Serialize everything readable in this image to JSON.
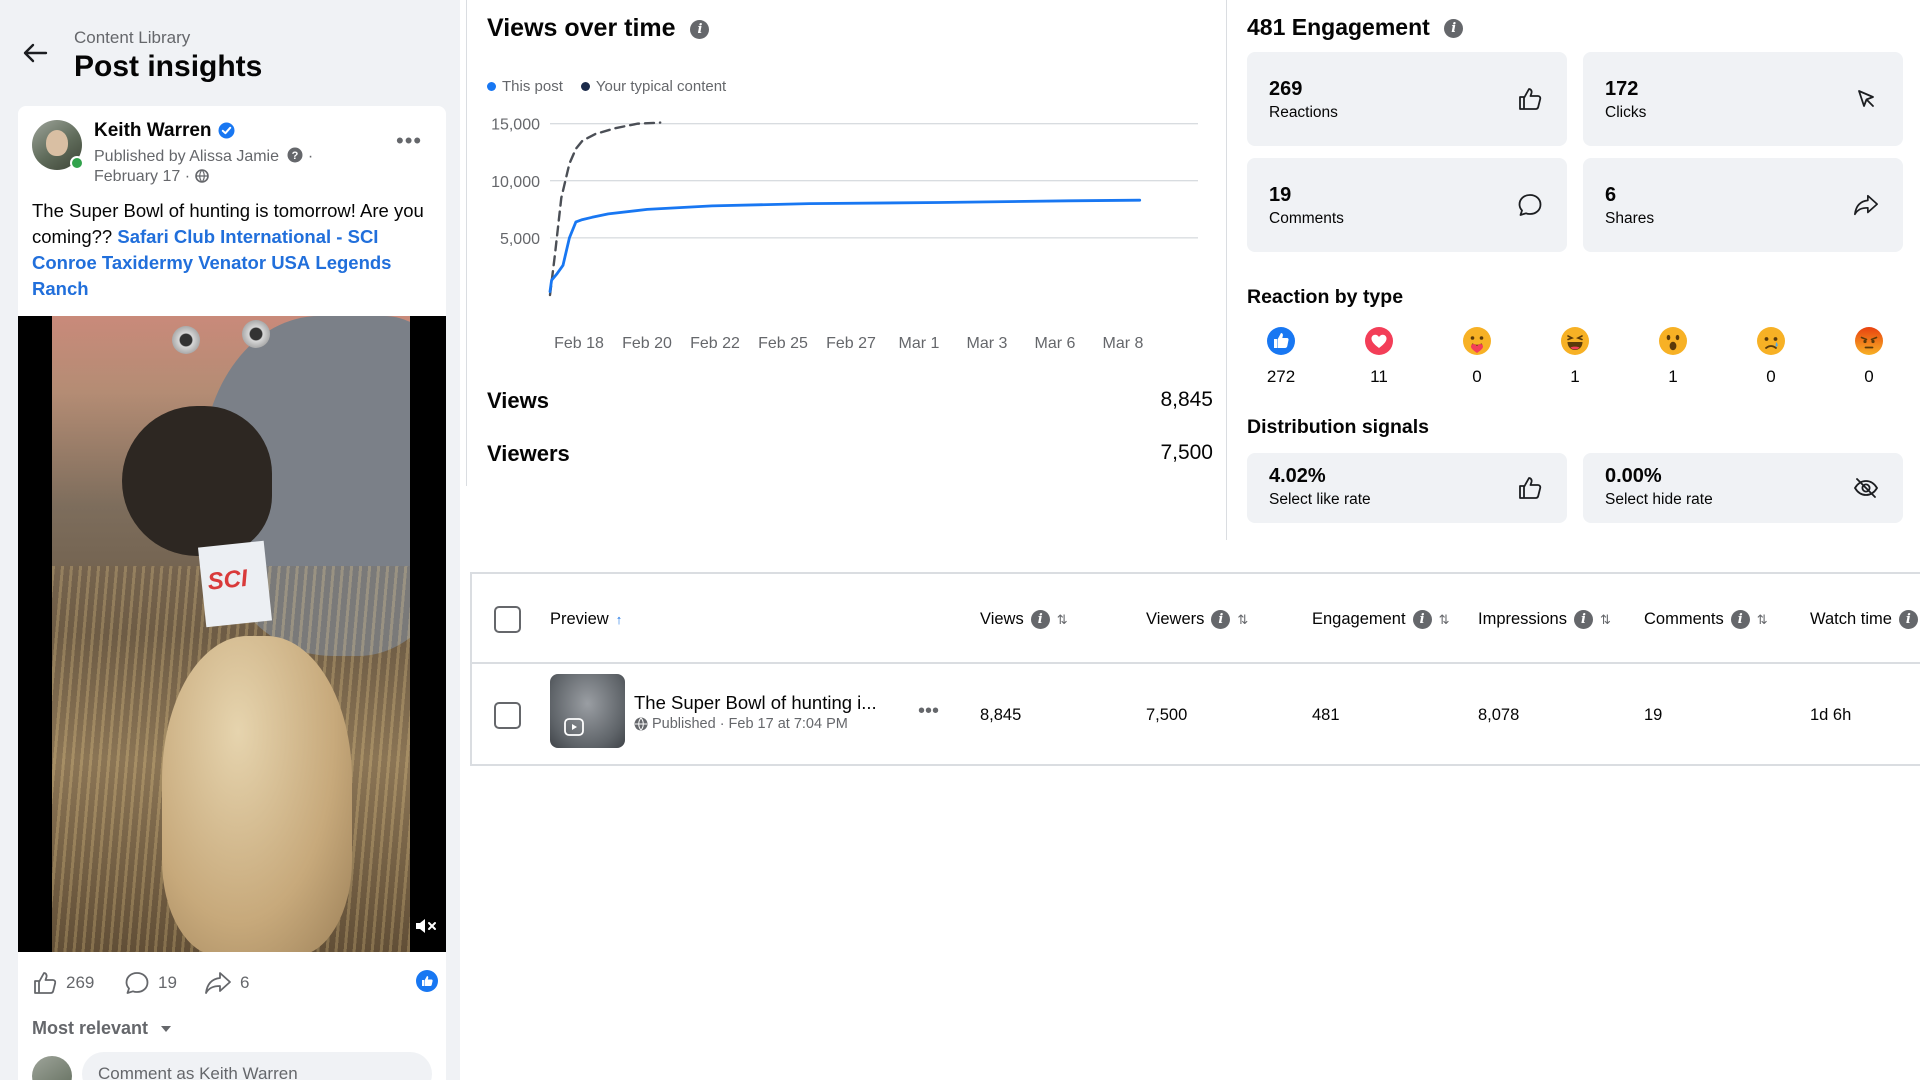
{
  "header": {
    "breadcrumb": "Content Library",
    "title": "Post insights"
  },
  "post": {
    "author": "Keith Warren",
    "published_prefix": "Published by",
    "published_by": "Alissa Jamie",
    "date": "February 17 ·",
    "text": "The Super Bowl of hunting is tomorrow! Are you coming??",
    "tags": [
      "Safari Club International -",
      "SCI Conroe Taxidermy",
      "Venator USA",
      "Legends Ranch"
    ],
    "video_sign_text": "SCI",
    "reactions_count": "269",
    "comments_count": "19",
    "shares_count": "6",
    "sort_label": "Most relevant",
    "comment_placeholder": "Comment as Keith Warren"
  },
  "views_chart": {
    "title": "Views over time",
    "legend": [
      {
        "label": "This post",
        "color": "#1877f2"
      },
      {
        "label": "Your typical content",
        "color": "#1c2b4a"
      }
    ],
    "views_label": "Views",
    "views_value": "8,845",
    "viewers_label": "Viewers",
    "viewers_value": "7,500"
  },
  "chart_data": {
    "type": "line",
    "x_tick_labels": [
      "Feb 18",
      "Feb 20",
      "Feb 22",
      "Feb 25",
      "Feb 27",
      "Mar 1",
      "Mar 3",
      "Mar 6",
      "Mar 8"
    ],
    "y_tick_labels": [
      "15,000",
      "10,000",
      "5,000"
    ],
    "y_ticks": [
      15000,
      10000,
      5000
    ],
    "ylim": [
      0,
      15500
    ],
    "xlim": [
      0,
      20
    ],
    "grid": true,
    "series": [
      {
        "name": "This post",
        "color": "#1877f2",
        "style": "solid",
        "x": [
          0,
          0.05,
          0.2,
          0.4,
          0.6,
          0.8,
          1,
          1.3,
          1.8,
          3,
          5,
          8,
          12,
          16,
          18.2
        ],
        "y": [
          300,
          1300,
          1800,
          2600,
          5000,
          6400,
          6600,
          6800,
          7100,
          7500,
          7800,
          8000,
          8100,
          8250,
          8300
        ]
      },
      {
        "name": "Your typical content",
        "color": "#4b4f56",
        "style": "dashed",
        "x": [
          0,
          0.15,
          0.35,
          0.6,
          0.8,
          1.0,
          1.4,
          2.0,
          2.7,
          3.4
        ],
        "y": [
          0,
          3500,
          8500,
          11500,
          12800,
          13500,
          14100,
          14600,
          15000,
          15100
        ]
      }
    ]
  },
  "engagement": {
    "title": "481 Engagement",
    "cards": [
      {
        "value": "269",
        "label": "Reactions",
        "icon": "thumbs-up-icon"
      },
      {
        "value": "172",
        "label": "Clicks",
        "icon": "cursor-click-icon"
      },
      {
        "value": "19",
        "label": "Comments",
        "icon": "comment-icon"
      },
      {
        "value": "6",
        "label": "Shares",
        "icon": "share-icon"
      }
    ],
    "reaction_title": "Reaction by type",
    "reactions": [
      {
        "type": "like",
        "count": "272",
        "color": "#1877f2"
      },
      {
        "type": "love",
        "count": "11",
        "color": "#f33e58"
      },
      {
        "type": "care",
        "count": "0",
        "color": "#f7b125"
      },
      {
        "type": "haha",
        "count": "1",
        "color": "#f7b125"
      },
      {
        "type": "wow",
        "count": "1",
        "color": "#f7b125"
      },
      {
        "type": "sad",
        "count": "0",
        "color": "#f7b125"
      },
      {
        "type": "angry",
        "count": "0",
        "color": "#e9710f"
      }
    ],
    "distribution_title": "Distribution signals",
    "distribution": [
      {
        "value": "4.02%",
        "label": "Select like rate",
        "icon": "thumbs-up-icon"
      },
      {
        "value": "0.00%",
        "label": "Select hide rate",
        "icon": "eye-off-icon"
      }
    ]
  },
  "table": {
    "columns": [
      "Preview",
      "Views",
      "Viewers",
      "Engagement",
      "Impressions",
      "Comments",
      "Watch time"
    ],
    "row": {
      "title": "The Super Bowl of hunting i...",
      "status": "Published",
      "published_at": "· Feb 17 at 7:04 PM",
      "views": "8,845",
      "viewers": "7,500",
      "engagement": "481",
      "impressions": "8,078",
      "comments": "19",
      "watch_time": "1d 6h"
    }
  }
}
